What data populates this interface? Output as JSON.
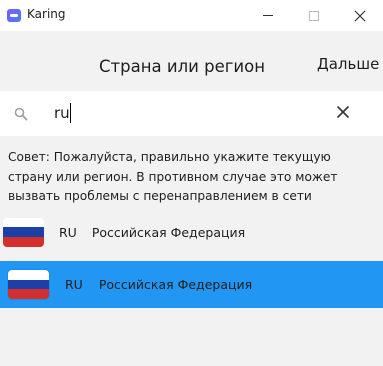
{
  "window": {
    "title": "Karing"
  },
  "header": {
    "title": "Страна или регион",
    "next_label": "Дальше"
  },
  "search": {
    "value": "ru",
    "icon": "search-icon",
    "clear_icon": "close-icon"
  },
  "tip": {
    "text": "Совет: Пожалуйста, правильно укажите текущую страну или регион. В противном случае это может вызвать проблемы с перенаправлением в сети"
  },
  "countries": [
    {
      "code": "RU",
      "name": "Российская Федерация",
      "selected": false
    },
    {
      "code": "RU",
      "name": "Российская Федерация",
      "selected": true
    }
  ],
  "colors": {
    "accent": "#2196f3",
    "background": "#f2f2f2",
    "titlebar": "#ffffff"
  }
}
